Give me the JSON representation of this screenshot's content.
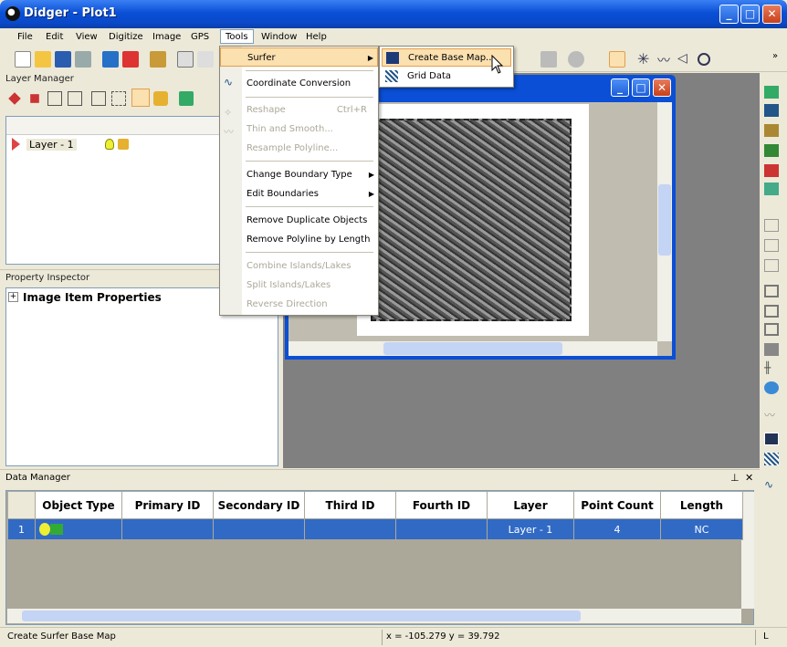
{
  "app": {
    "title": "Didger - Plot1"
  },
  "menubar": {
    "items": [
      "File",
      "Edit",
      "View",
      "Digitize",
      "Image",
      "GPS",
      "Tools",
      "Window",
      "Help"
    ]
  },
  "layer_manager": {
    "title": "Layer Manager",
    "layer": "Layer - 1"
  },
  "property_inspector": {
    "title": "Property Inspector",
    "section": "Image Item Properties"
  },
  "tools_menu": {
    "surfer": "Surfer",
    "coordinate_conversion": "Coordinate Conversion",
    "reshape": "Reshape",
    "reshape_shortcut": "Ctrl+R",
    "thin_smooth": "Thin and Smooth...",
    "resample": "Resample Polyline...",
    "change_boundary": "Change Boundary Type",
    "edit_boundaries": "Edit Boundaries",
    "remove_duplicates": "Remove Duplicate Objects",
    "remove_polyline": "Remove Polyline by Length",
    "combine_islands": "Combine Islands/Lakes",
    "split_islands": "Split Islands/Lakes",
    "reverse_direction": "Reverse Direction"
  },
  "surfer_submenu": {
    "create_base_map": "Create Base Map...",
    "grid_data": "Grid Data"
  },
  "data_manager": {
    "title": "Data Manager",
    "columns": [
      "Object Type",
      "Primary ID",
      "Secondary ID",
      "Third ID",
      "Fourth ID",
      "Layer",
      "Point Count",
      "Length"
    ],
    "row": {
      "num": "1",
      "object_type": "",
      "primary": "",
      "secondary": "",
      "third": "",
      "fourth": "",
      "layer": "Layer - 1",
      "point_count": "4",
      "length": "NC"
    }
  },
  "status": {
    "left": "Create Surfer Base Map",
    "coords": "x = -105.279  y = 39.792",
    "right": "L"
  },
  "colors": {
    "accent": "#316ac5",
    "menu_highlight": "#fbe0b0"
  }
}
